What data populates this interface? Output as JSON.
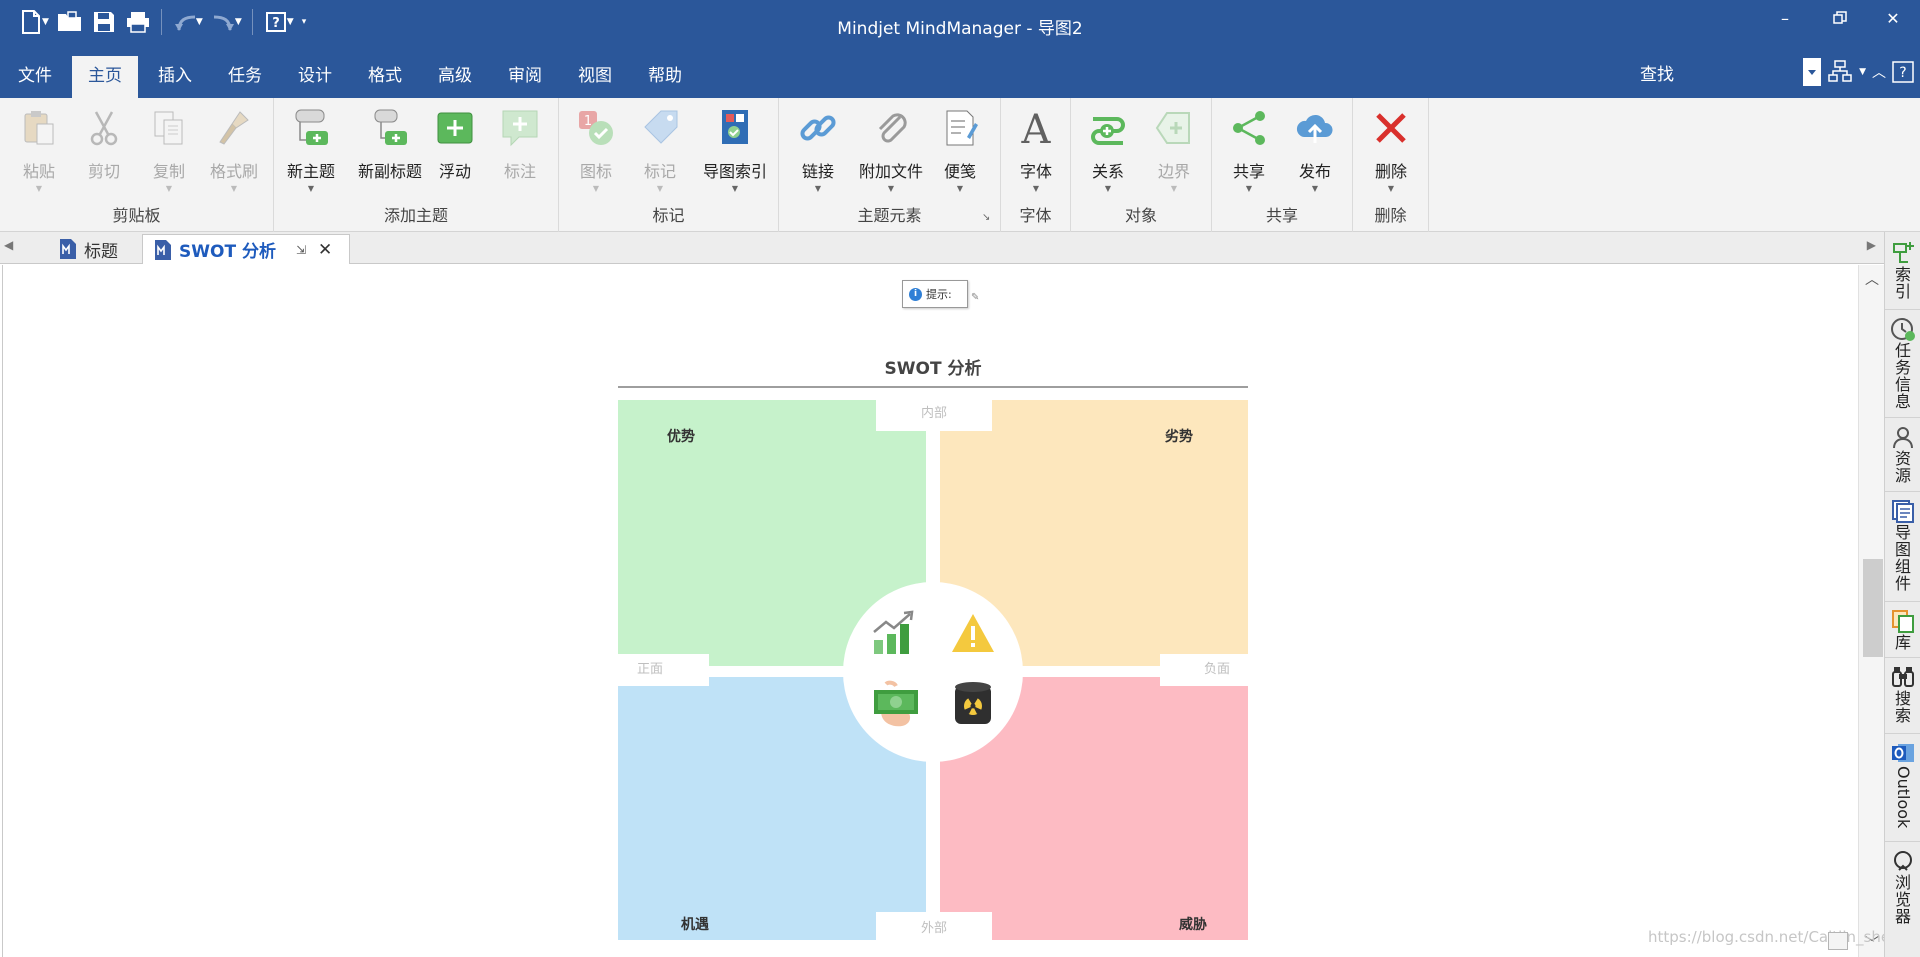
{
  "window": {
    "title": "Mindjet MindManager - 导图2"
  },
  "menu_tabs": [
    {
      "label": "文件"
    },
    {
      "label": "主页"
    },
    {
      "label": "插入"
    },
    {
      "label": "任务"
    },
    {
      "label": "设计"
    },
    {
      "label": "格式"
    },
    {
      "label": "高级"
    },
    {
      "label": "审阅"
    },
    {
      "label": "视图"
    },
    {
      "label": "帮助"
    }
  ],
  "search_label": "查找",
  "ribbon": {
    "groups": [
      {
        "label": "剪贴板",
        "buttons": [
          {
            "label": "粘贴"
          },
          {
            "label": "剪切"
          },
          {
            "label": "复制"
          },
          {
            "label": "格式刷"
          }
        ]
      },
      {
        "label": "添加主题",
        "buttons": [
          {
            "label": "新主题"
          },
          {
            "label": "新副标题"
          },
          {
            "label": "浮动"
          },
          {
            "label": "标注"
          }
        ]
      },
      {
        "label": "标记",
        "buttons": [
          {
            "label": "图标"
          },
          {
            "label": "标记"
          },
          {
            "label": "导图索引"
          }
        ]
      },
      {
        "label": "主题元素",
        "buttons": [
          {
            "label": "链接"
          },
          {
            "label": "附加文件"
          },
          {
            "label": "便笺"
          }
        ]
      },
      {
        "label": "字体",
        "buttons": [
          {
            "label": "字体"
          }
        ]
      },
      {
        "label": "对象",
        "buttons": [
          {
            "label": "关系"
          },
          {
            "label": "边界"
          }
        ]
      },
      {
        "label": "共享",
        "buttons": [
          {
            "label": "共享"
          },
          {
            "label": "发布"
          }
        ]
      },
      {
        "label": "删除",
        "buttons": [
          {
            "label": "删除"
          }
        ]
      }
    ]
  },
  "doc_tabs": [
    {
      "label": "标题"
    },
    {
      "label": "SWOT 分析"
    }
  ],
  "canvas": {
    "tip_label": "提示:",
    "swot_title": "SWOT 分析",
    "quadrants": {
      "strengths": "优势",
      "weaknesses": "劣势",
      "opportunities": "机遇",
      "threats": "威胁"
    },
    "axes": {
      "internal": "内部",
      "external": "外部",
      "positive": "正面",
      "negative": "负面"
    },
    "watermark": "https://blog.csdn.net/Caitlin_sheep"
  },
  "side_panel": [
    {
      "label": "索引"
    },
    {
      "label": "任务信息"
    },
    {
      "label": "资源"
    },
    {
      "label": "导图组件"
    },
    {
      "label": "库"
    },
    {
      "label": "搜索"
    },
    {
      "label": "Outlook"
    },
    {
      "label": "浏览器"
    }
  ],
  "colors": {
    "title_bar": "#2b579a",
    "strengths": "#c6f2cb",
    "weaknesses": "#fde7bd",
    "opportunities": "#bfe2f7",
    "threats": "#fdbbc3"
  }
}
